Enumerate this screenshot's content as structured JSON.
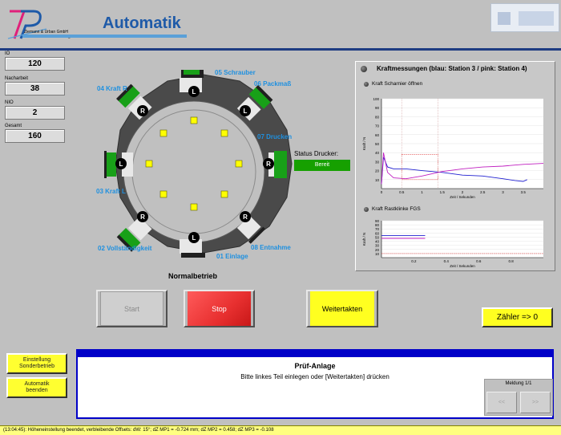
{
  "header": {
    "title": "Automatik",
    "logo_line1": "Ziemann & Urban GmbH",
    "logo_line2": "Prüf- und Automatisierungstechnik"
  },
  "counters": [
    {
      "label": "IO",
      "value": "120"
    },
    {
      "label": "Nacharbeit",
      "value": "38"
    },
    {
      "label": "NIO",
      "value": "2"
    },
    {
      "label": "Gesamt",
      "value": "160"
    }
  ],
  "stations": {
    "s01": "01 Einlage",
    "s02": "02 Vollständigkeit",
    "s03": "03 Kraft L",
    "s04": "04 Kraft R",
    "s05": "05 Schrauber",
    "s06": "06 Packmaß",
    "s07": "07 Drucken",
    "s08": "08 Entnahme"
  },
  "station_marks": [
    "L",
    "R",
    "L",
    "R",
    "L",
    "R",
    "L",
    "R"
  ],
  "printer": {
    "label": "Status Drucker:",
    "status": "Bereit"
  },
  "mode": "Normalbetrieb",
  "buttons": {
    "start": "Start",
    "stop": "Stop",
    "weiter": "Weitertakten",
    "zaehler": "Zähler => 0",
    "sonder_line1": "Einstellung",
    "sonder_line2": "Sonderbetrieb",
    "auto_line1": "Automatik",
    "auto_line2": "beenden"
  },
  "message": {
    "title": "Prüf-Anlage",
    "text": "Bitte linkes Teil einlegen oder [Weitertakten] drücken",
    "meldung": "Meldung 1/1",
    "prev": "<<",
    "next": ">>"
  },
  "statusbar": "(13:04:45): Höheneinstellung beendet, verbleibende Offsets: dW: 15°;  dZ MP1 = -0.724 mm; dZ MP2 = 0.458; dZ MP3 = -0.108",
  "colors": {
    "accent": "#1e5aa8",
    "station_label": "#1e90e0",
    "stop": "#e83030",
    "go": "#ffff20",
    "ok": "#16a000"
  },
  "chart_data": [
    {
      "type": "line",
      "title": "Kraftmessungen  (blau: Station 3 / pink: Station 4)",
      "subtitle": "Kraft Scharnier öffnen",
      "xlabel": "Zeit / Sekunden",
      "ylabel": "Kraft / N",
      "xlim": [
        0,
        4
      ],
      "ylim": [
        0,
        100
      ],
      "xticks": [
        0,
        0.5,
        1,
        1.5,
        2,
        2.5,
        3,
        3.5
      ],
      "yticks": [
        10,
        20,
        30,
        40,
        50,
        60,
        70,
        80,
        90,
        100
      ],
      "series": [
        {
          "color": "#2020d0",
          "x": [
            0,
            0.05,
            0.15,
            0.3,
            0.6,
            1.0,
            1.5,
            2.0,
            2.5,
            3.0,
            3.3,
            3.5,
            3.6
          ],
          "y": [
            5,
            35,
            24,
            22,
            22,
            20,
            18,
            15,
            14,
            11,
            9,
            8,
            10
          ]
        },
        {
          "color": "#c020c0",
          "x": [
            0,
            0.05,
            0.15,
            0.3,
            0.6,
            1.0,
            1.5,
            2.0,
            2.5,
            3.0,
            3.5,
            4.0
          ],
          "y": [
            5,
            40,
            18,
            12,
            11,
            14,
            19,
            22,
            24,
            25,
            27,
            28
          ]
        }
      ]
    },
    {
      "type": "line",
      "subtitle": "Kraft Rastklinke FGS",
      "xlabel": "Zeit / Sekunden",
      "ylabel": "Kraft / N",
      "xlim": [
        0,
        1
      ],
      "ylim": [
        0,
        90
      ],
      "xticks": [
        0.2,
        0.4,
        0.6,
        0.8
      ],
      "yticks": [
        10,
        20,
        30,
        40,
        50,
        60,
        70,
        80,
        90
      ],
      "series": [
        {
          "color": "#2020d0",
          "x": [
            0,
            0.27
          ],
          "y": [
            54,
            54
          ]
        },
        {
          "color": "#c020c0",
          "x": [
            0,
            0.27
          ],
          "y": [
            47,
            47
          ]
        }
      ]
    }
  ]
}
